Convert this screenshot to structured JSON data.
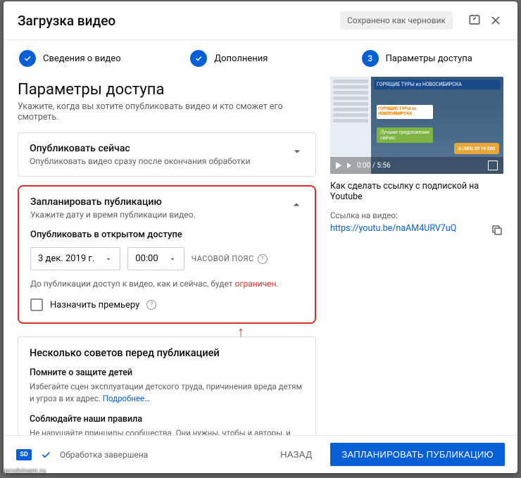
{
  "header": {
    "title": "Загрузка видео",
    "draft": "Сохранено как черновик"
  },
  "steps": {
    "s1": "Сведения о видео",
    "s2": "Дополнения",
    "s3n": "3",
    "s3": "Параметры доступа"
  },
  "page": {
    "h": "Параметры доступа",
    "sub": "Укажите, когда вы хотите опубликовать видео и кто сможет его смотреть."
  },
  "now": {
    "t": "Опубликовать сейчас",
    "s": "Опубликовать видео сразу после окончания обработки"
  },
  "sched": {
    "t": "Запланировать публикацию",
    "s": "Укажите дату и время публикации видео.",
    "pub": "Опубликовать в открытом доступе",
    "date": "3 дек. 2019 г.",
    "time": "00:00",
    "tz": "ЧАСОВОЙ ПОЯС",
    "restr1": "До публикации доступ к видео, как и сейчас, будет ",
    "restr2": "ограничен",
    "restr3": ".",
    "prem": "Назначить премьеру"
  },
  "tips": {
    "t": "Несколько советов перед публикацией",
    "t1": "Помните о защите детей",
    "d1": "Избегайте сцен эксплуатации детского труда, причинения вреда детям и угроз в их адрес. ",
    "t2": "Соблюдайте наши правила",
    "d2": "Не нарушайте принципы сообщества. Они нужны, чтобы и авторы, и зрители чувствовали себя на нашей платформе комфортно. ",
    "more": "Подробнее…"
  },
  "preview": {
    "vk": "w",
    "banner": "ГОРЯЩИЕ ТУРЫ из НОВОСИБИРСКА",
    "b2": "ГОРЯЩИЕ ТУРЫ из НОВОСИБИРСКА",
    "green": "Лучшие предложения сейчас",
    "cloud": "8 (383) 29 19 200",
    "time": "0:00 / 5:56",
    "title": "Как сделать ссылку с подпиской на Youtube",
    "ll": "Ссылка на видео:",
    "url": "https://youtu.be/naAM4URV7uQ"
  },
  "footer": {
    "sd": "SD",
    "stat": "Обработка завершена",
    "back": "НАЗАД",
    "go": "ЗАПЛАНИРОВАТЬ ПУБЛИКАЦИЮ"
  },
  "wm": "iprodvinem.ru"
}
